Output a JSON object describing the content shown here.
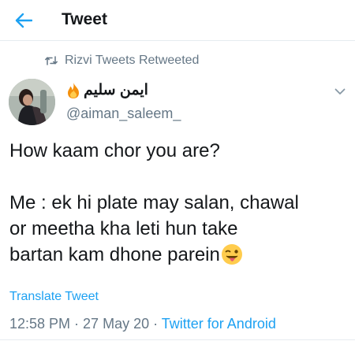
{
  "header": {
    "back_icon": "arrow-left-icon",
    "title": "Tweet"
  },
  "retweet": {
    "icon": "retweet-icon",
    "text": "Rizvi Tweets Retweeted"
  },
  "author": {
    "display_name": "ایمن سلیم",
    "name_emoji": "fire-icon",
    "handle": "@aiman_saleem_"
  },
  "tweet": {
    "line1": "How kaam chor you are?",
    "line2": "Me : ek hi plate may salan, chawal",
    "line3": "or meetha kha leti hun take",
    "line4": "bartan kam dhone parein",
    "end_emoji": "winking-face-with-tongue-icon"
  },
  "translate_label": "Translate Tweet",
  "meta": {
    "time": "12:58 PM",
    "sep1": " · ",
    "date": "27 May 20",
    "sep2": " · ",
    "source": "Twitter for Android"
  },
  "colors": {
    "accent": "#1da1f2",
    "secondary_text": "#657786",
    "primary_text": "#14171a"
  }
}
